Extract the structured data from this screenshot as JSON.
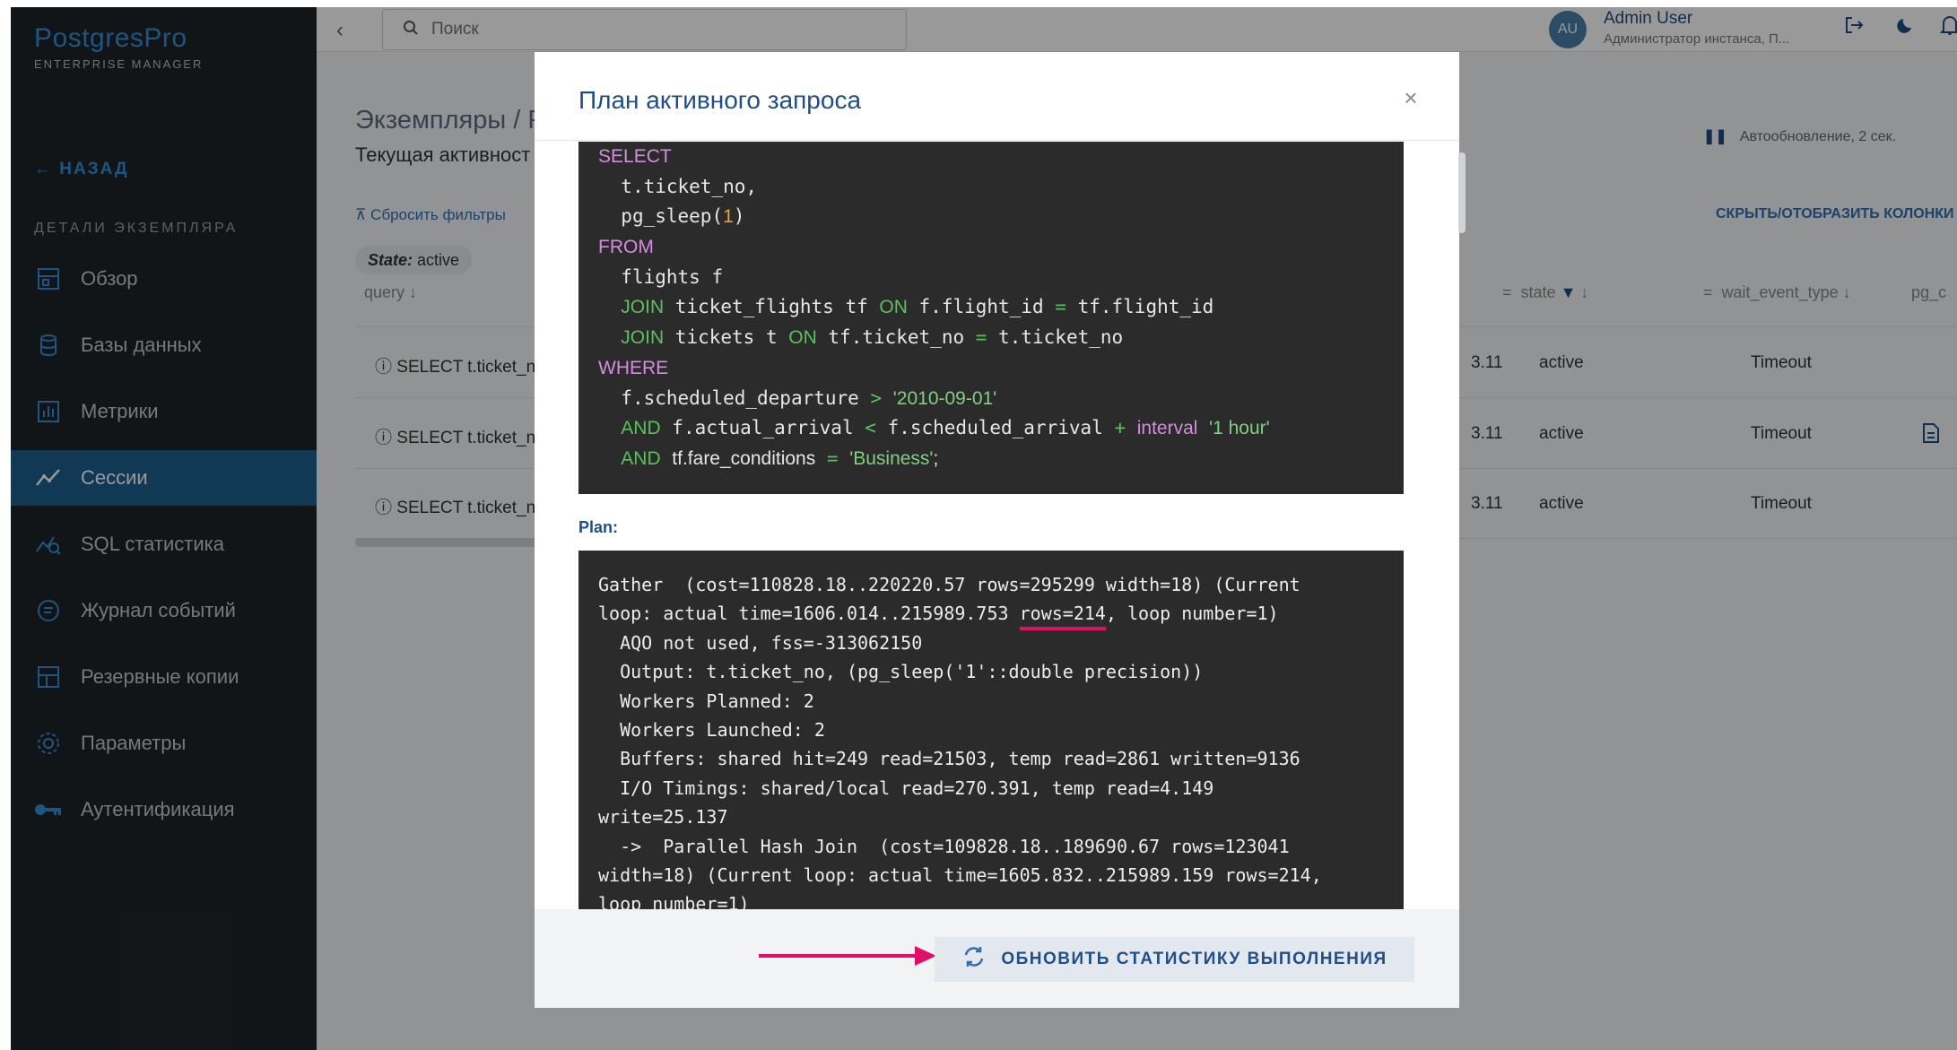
{
  "logo": {
    "main": "PostgresPro",
    "sub": "ENTERPRISE MANAGER"
  },
  "sidebar": {
    "back": "← НАЗАД",
    "section": "ДЕТАЛИ ЭКЗЕМПЛЯРА",
    "items": [
      {
        "label": "Обзор",
        "icon": "overview-icon"
      },
      {
        "label": "Базы данных",
        "icon": "database-icon"
      },
      {
        "label": "Метрики",
        "icon": "metrics-icon"
      },
      {
        "label": "Сессии",
        "icon": "sessions-icon",
        "active": true
      },
      {
        "label": "SQL статистика",
        "icon": "sql-stats-icon"
      },
      {
        "label": "Журнал событий",
        "icon": "events-icon"
      },
      {
        "label": "Резервные копии",
        "icon": "backup-icon"
      },
      {
        "label": "Параметры",
        "icon": "gear-icon"
      },
      {
        "label": "Аутентификация",
        "icon": "key-icon"
      }
    ]
  },
  "topbar": {
    "search_placeholder": "Поиск",
    "avatar": "AU",
    "user_name": "Admin User",
    "user_role": "Администратор инстанса, П..."
  },
  "main": {
    "breadcrumb": "Экземпляры / Р",
    "subtitle": "Текущая активност",
    "autoupdate": "Автообновление, 2 сек.",
    "reset_filters": "Сбросить фильтры",
    "toggle_columns": "СКРЫТЬ/ОТОБРАЗИТЬ КОЛОНКИ",
    "chip_key": "State:",
    "chip_value": "active",
    "columns": {
      "query": "query",
      "state": "state",
      "wait_event_type": "wait_event_type",
      "pg": "pg_c"
    },
    "rows": [
      {
        "query": "SELECT t.ticket_nc",
        "ver": "3.11",
        "state": "active",
        "wait": "Timeout"
      },
      {
        "query": "SELECT t.ticket_nc",
        "ver": "3.11",
        "state": "active",
        "wait": "Timeout"
      },
      {
        "query": "SELECT t.ticket_nc",
        "ver": "3.11",
        "state": "active",
        "wait": "Timeout"
      }
    ]
  },
  "modal": {
    "title": "План активного запроса",
    "close": "×",
    "sql": {
      "select": "SELECT",
      "col1": "t.ticket_no,",
      "sleep": "pg_sleep(",
      "sleep_arg": "1",
      "sleep_close": ")",
      "from": "FROM",
      "flights": "flights f",
      "join": "JOIN",
      "on": "ON",
      "j1_table": "ticket_flights tf",
      "j1_left": "f.flight_id",
      "eq": "=",
      "j1_right": "tf.flight_id",
      "j2_table": "tickets t",
      "j2_left": "tf.ticket_no",
      "j2_right": "t.ticket_no",
      "where": "WHERE",
      "w1_col": "f.scheduled_departure",
      "gt": ">",
      "w1_val": "'2010-09-01'",
      "and": "AND",
      "w2_col": "f.actual_arrival",
      "lt": "<",
      "w2_col2": "f.scheduled_arrival",
      "plus": "+",
      "interval": "interval",
      "w2_val": "'1 hour'",
      "w3_col": "tf.fare_conditions",
      "w3_val": "'Business'",
      "semicolon": ";"
    },
    "plan_label": "Plan:",
    "plan": {
      "l1": "Gather  (cost=110828.18..220220.57 rows=295299 width=18) (Current",
      "l2a": "loop: actual time=1606.014..215989.753 ",
      "l2b": "rows=214",
      "l2c": ", loop number=1)",
      "l3": "  AQO not used, fss=-313062150",
      "l4": "  Output: t.ticket_no, (pg_sleep('1'::double precision))",
      "l5": "  Workers Planned: 2",
      "l6": "  Workers Launched: 2",
      "l7": "  Buffers: shared hit=249 read=21503, temp read=2861 written=9136",
      "l8": "  I/O Timings: shared/local read=270.391, temp read=4.149",
      "l9": "write=25.137",
      "l10": "  ->  Parallel Hash Join  (cost=109828.18..189690.67 rows=123041",
      "l11": "width=18) (Current loop: actual time=1605.832..215989.159 rows=214,",
      "l12": "loop number=1)"
    },
    "refresh_button": "ОБНОВИТЬ СТАТИСТИКУ ВЫПОЛНЕНИЯ"
  },
  "colors": {
    "accent": "#1f4e88",
    "highlight": "#e0106a",
    "sidebar_active": "#1d5f8e"
  }
}
